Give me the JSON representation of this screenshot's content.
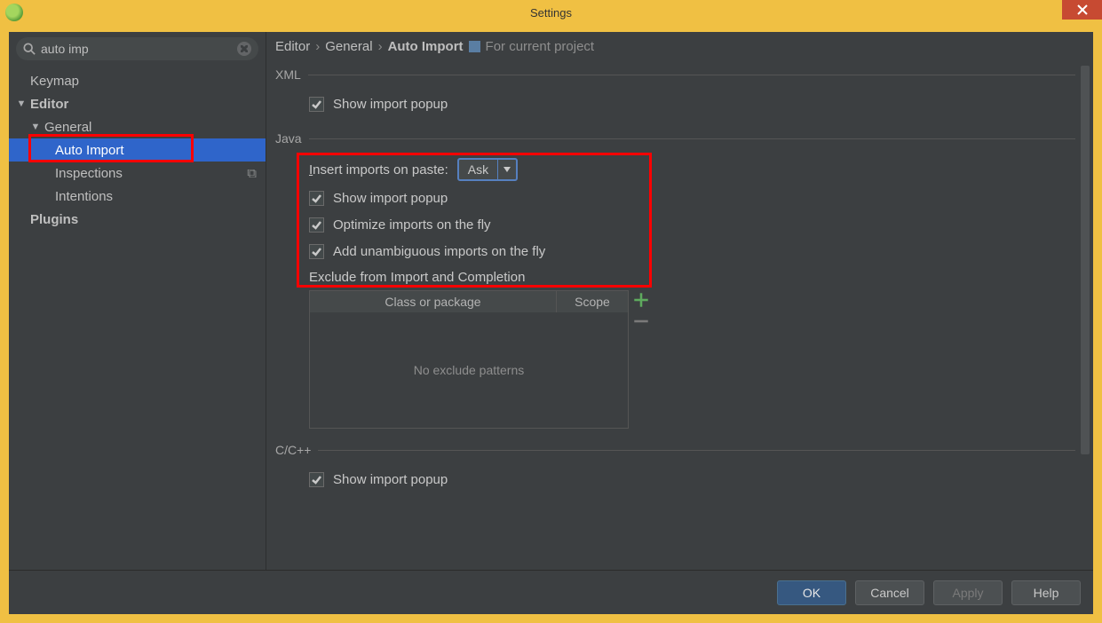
{
  "window": {
    "title": "Settings"
  },
  "search": {
    "value": "auto imp"
  },
  "tree": {
    "keymap": "Keymap",
    "editor": "Editor",
    "general": "General",
    "auto_import": "Auto Import",
    "inspections": "Inspections",
    "intentions": "Intentions",
    "plugins": "Plugins"
  },
  "breadcrumb": {
    "p1": "Editor",
    "p2": "General",
    "p3": "Auto Import",
    "proj": "For current project"
  },
  "groups": {
    "xml": {
      "title": "XML",
      "show_popup": "Show import popup"
    },
    "java": {
      "title": "Java",
      "insert_label": "Insert imports on paste:",
      "insert_value": "Ask",
      "show_popup": "Show import popup",
      "optimize": "Optimize imports on the fly",
      "unambiguous": "Add unambiguous imports on the fly",
      "exclude_label": "Exclude from Import and Completion",
      "col1": "Class or package",
      "col2": "Scope",
      "empty": "No exclude patterns"
    },
    "cpp": {
      "title": "C/C++",
      "show_popup": "Show import popup"
    }
  },
  "buttons": {
    "ok": "OK",
    "cancel": "Cancel",
    "apply": "Apply",
    "help": "Help"
  }
}
